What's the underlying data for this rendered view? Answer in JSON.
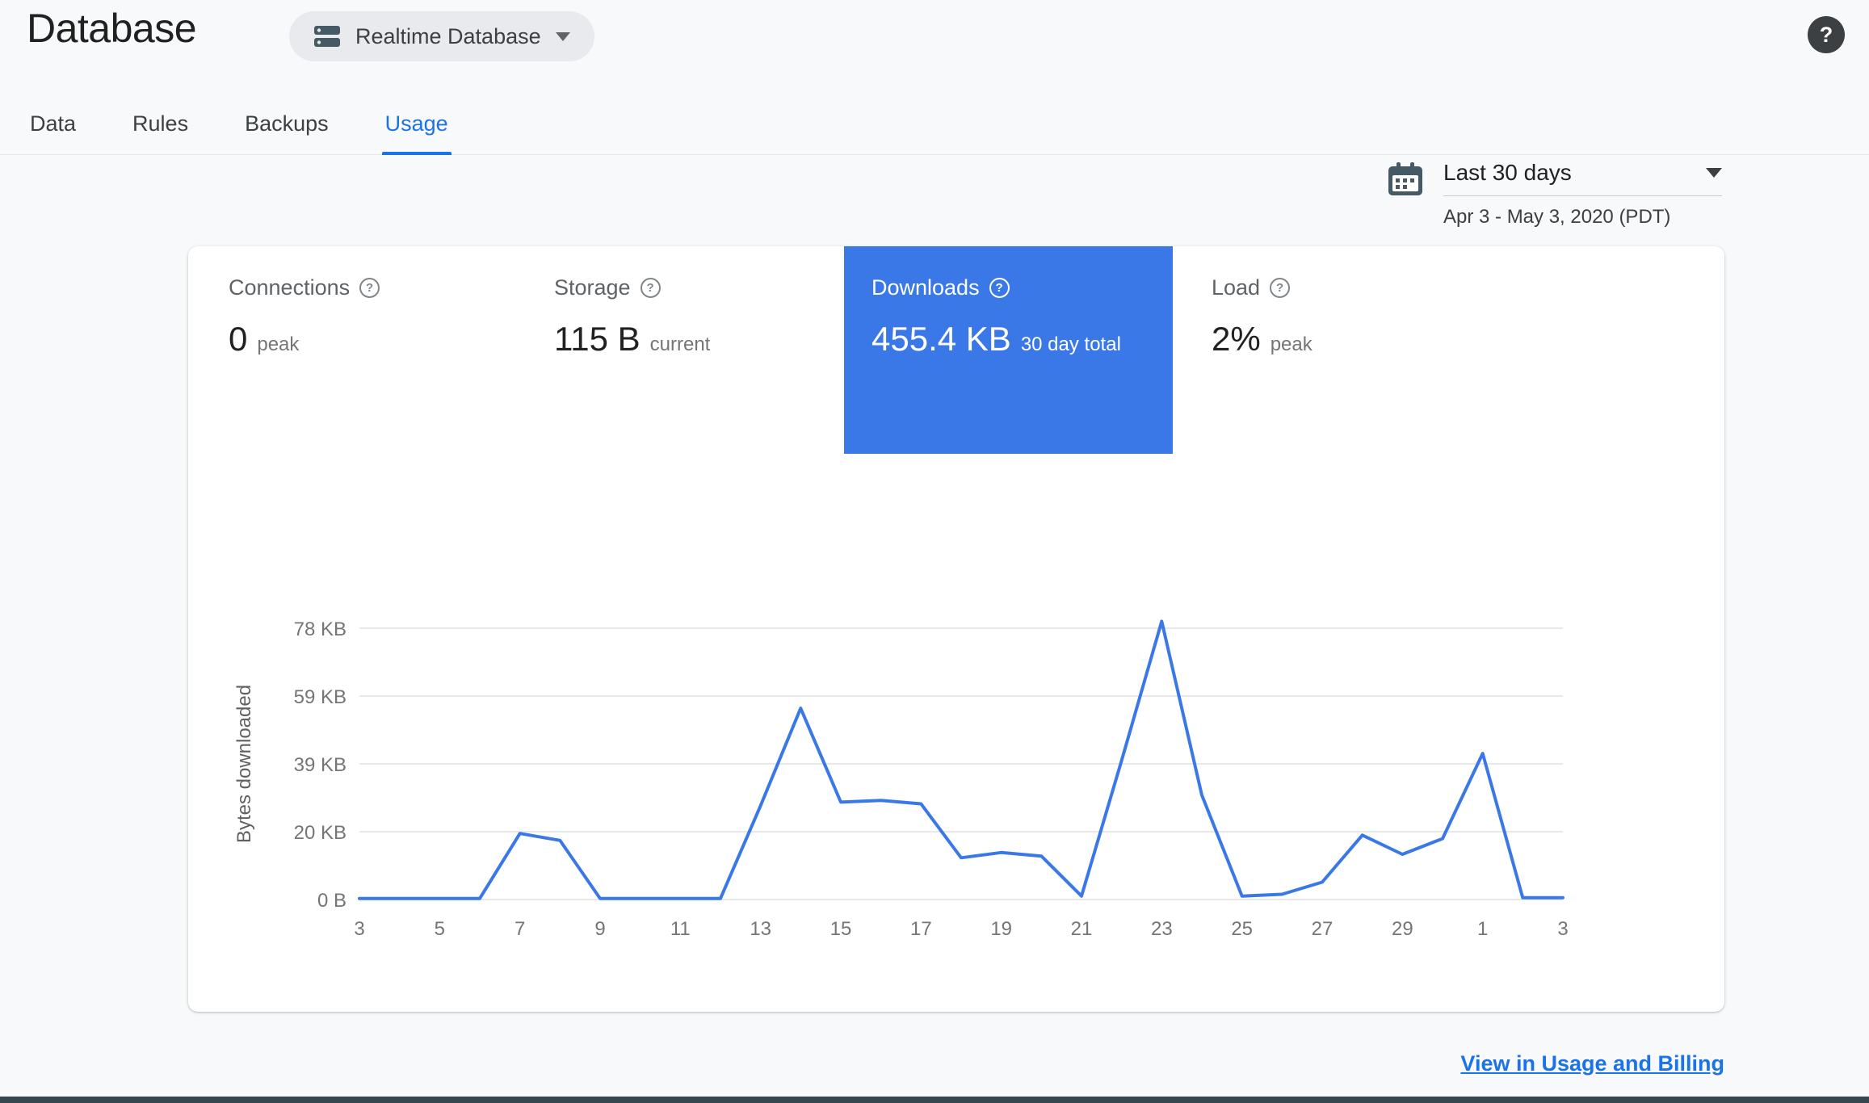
{
  "colors": {
    "accent": "#3b78e7",
    "active_tab": "#1a73e8",
    "tile_selected_bg": "#3b78e7"
  },
  "header": {
    "title": "Database",
    "database_selector": "Realtime Database",
    "help_glyph": "?"
  },
  "tabs": [
    {
      "label": "Data"
    },
    {
      "label": "Rules"
    },
    {
      "label": "Backups"
    },
    {
      "label": "Usage"
    }
  ],
  "active_tab": "Usage",
  "date_range": {
    "preset": "Last 30 days",
    "detail": "Apr 3 - May 3, 2020 (PDT)"
  },
  "metrics": [
    {
      "name": "Connections",
      "help_glyph": "?",
      "value": "0",
      "unit": "peak",
      "selected": false
    },
    {
      "name": "Storage",
      "help_glyph": "?",
      "value": "115 B",
      "unit": "current",
      "selected": false
    },
    {
      "name": "Downloads",
      "help_glyph": "?",
      "value": "455.4 KB",
      "unit": "30 day total",
      "selected": true
    },
    {
      "name": "Load",
      "help_glyph": "?",
      "value": "2%",
      "unit": "peak",
      "selected": false
    }
  ],
  "footer": {
    "link": "View in Usage and Billing"
  },
  "chart_data": {
    "type": "line",
    "ylabel": "Bytes downloaded",
    "grid": true,
    "legend": false,
    "ylim_kb": [
      0,
      83
    ],
    "x_tick_labels": [
      "3",
      "5",
      "7",
      "9",
      "11",
      "13",
      "15",
      "17",
      "19",
      "21",
      "23",
      "25",
      "27",
      "29",
      "1",
      "3"
    ],
    "y_ticks": [
      {
        "label": "0 B",
        "kb": 0
      },
      {
        "label": "20 KB",
        "kb": 19.5
      },
      {
        "label": "39 KB",
        "kb": 39
      },
      {
        "label": "59 KB",
        "kb": 58.5
      },
      {
        "label": "78 KB",
        "kb": 78
      }
    ],
    "series": [
      {
        "name": "Bytes downloaded (KB per day, Apr 3 - May 3)",
        "values": [
          0.3,
          0.3,
          0.3,
          0.3,
          19,
          17,
          0.3,
          0.3,
          0.3,
          0.3,
          27,
          55,
          28,
          28.5,
          27.5,
          12,
          13.5,
          12.5,
          1,
          40,
          80,
          30,
          1,
          1.5,
          5,
          18.5,
          13,
          17.5,
          42,
          0.5,
          0.5
        ]
      }
    ],
    "colors": {
      "line": "#3b78e7",
      "grid": "#e0e0e0",
      "tick_text": "#757575"
    }
  }
}
